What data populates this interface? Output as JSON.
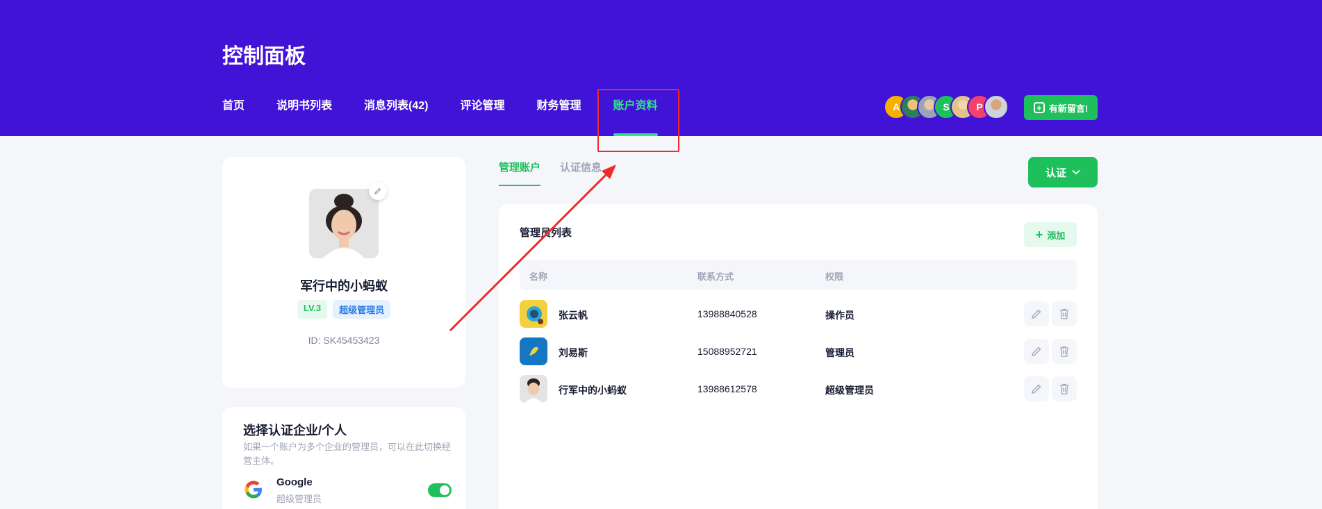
{
  "header": {
    "title": "控制面板",
    "nav": [
      "首页",
      "说明书列表",
      "消息列表(42)",
      "评论管理",
      "财务管理",
      "账户资料"
    ],
    "active_nav": "账户资料",
    "avatars": [
      "A",
      "",
      "",
      "S",
      "",
      "P",
      ""
    ],
    "message_button": "有新留言!"
  },
  "profile": {
    "name": "军行中的小蚂蚁",
    "level": "LV.3",
    "role": "超级管理员",
    "id": "ID: SK45453423"
  },
  "select_entity": {
    "title": "选择认证企业/个人",
    "description": "如果一个账户为多个企业的管理员，可以在此切换经营主体。",
    "accounts": [
      {
        "name": "Google",
        "role": "超级管理员",
        "enabled": true
      }
    ]
  },
  "subtabs": [
    "管理账户",
    "认证信息"
  ],
  "verify_button": "认证",
  "admin_list": {
    "title": "管理员列表",
    "add_button": "添加",
    "columns": [
      "名称",
      "联系方式",
      "权限"
    ],
    "rows": [
      {
        "name": "张云帆",
        "phone": "13988840528",
        "role": "操作员"
      },
      {
        "name": "刘易斯",
        "phone": "15088952721",
        "role": "管理员"
      },
      {
        "name": "行军中的小蚂蚁",
        "phone": "13988612578",
        "role": "超级管理员"
      }
    ]
  },
  "colors": {
    "header_bg": "#4013d6",
    "accent_green": "#1ec05c",
    "nav_active": "#35e08f",
    "annotation_red": "#f02a2a"
  }
}
